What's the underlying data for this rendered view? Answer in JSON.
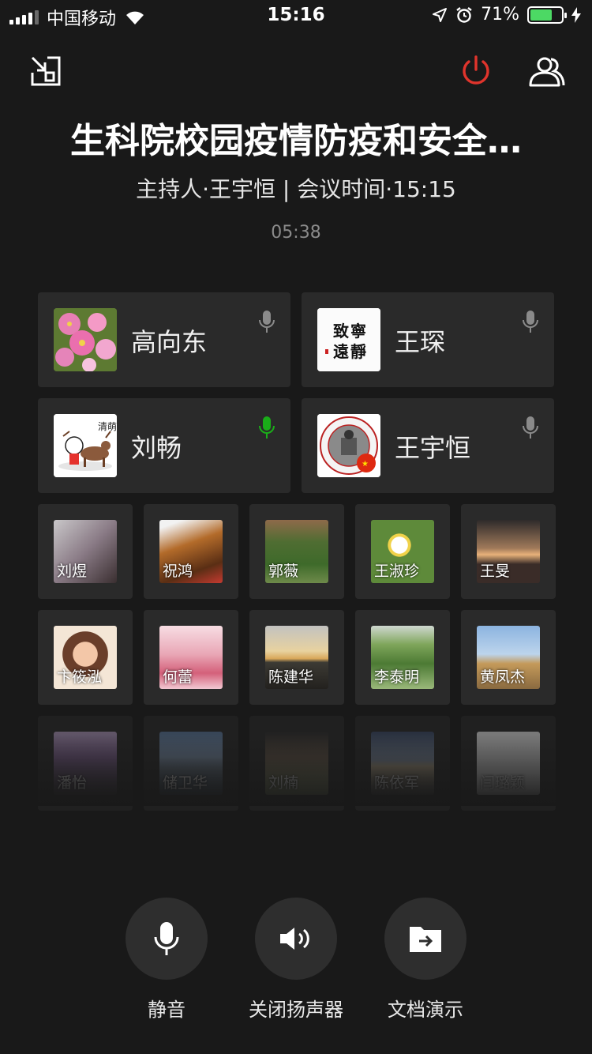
{
  "status_bar": {
    "carrier": "中国移动",
    "time": "15:16",
    "battery": "71%",
    "battery_level": 0.71,
    "icons": [
      "signal-icon",
      "wifi-icon",
      "location-icon",
      "alarm-icon",
      "battery-icon",
      "charging-icon"
    ]
  },
  "meeting": {
    "title": "生科院校园疫情防疫和安全…",
    "subtitle": "主持人·王宇恒 | 会议时间·15:15",
    "duration": "05:38"
  },
  "speakers": [
    {
      "name": "高向东",
      "mic_active": false
    },
    {
      "name": "王琛",
      "mic_active": false
    },
    {
      "name": "刘畅",
      "mic_active": true
    },
    {
      "name": "王宇恒",
      "mic_active": false
    }
  ],
  "avatar_text": {
    "wang_chen": [
      "致",
      "寧",
      "遠",
      "靜"
    ],
    "liu_chang": "清萌"
  },
  "participants": [
    {
      "name": "刘煜"
    },
    {
      "name": "祝鸿"
    },
    {
      "name": "郭薇"
    },
    {
      "name": "王淑珍"
    },
    {
      "name": "王旻"
    },
    {
      "name": "卞筱泓"
    },
    {
      "name": "何蕾"
    },
    {
      "name": "陈建华"
    },
    {
      "name": "李泰明"
    },
    {
      "name": "黄凤杰"
    },
    {
      "name": "潘怡"
    },
    {
      "name": "储卫华"
    },
    {
      "name": "刘楠"
    },
    {
      "name": "陈依军"
    },
    {
      "name": "闫璐颖"
    }
  ],
  "toolbar": {
    "mute_label": "静音",
    "speaker_label": "关闭扬声器",
    "share_label": "文档演示"
  },
  "colors": {
    "background": "#191919",
    "card": "#2a2a2a",
    "end_call": "#e0342c",
    "mic_active": "#1aad19",
    "mic_idle": "#8a8a8a"
  }
}
